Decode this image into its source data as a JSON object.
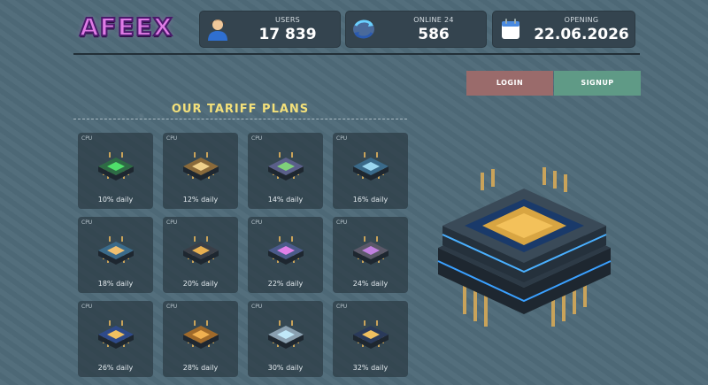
{
  "brand": {
    "logo_text": "AFEEX"
  },
  "stats": [
    {
      "label": "USERS",
      "value": "17 839",
      "icon": "user-icon"
    },
    {
      "label": "ONLINE 24",
      "value": "586",
      "icon": "sync-arrows-icon"
    },
    {
      "label": "OPENING",
      "value": "22.06.2026",
      "icon": "calendar-icon"
    }
  ],
  "auth": {
    "login_label": "LOGIN",
    "signup_label": "SIGNUP"
  },
  "plans": {
    "title": "OUR TARIFF PLANS",
    "items": [
      {
        "tag": "CPU",
        "rate": "10% daily",
        "core": "#4fe06a",
        "body": "#2e6b45"
      },
      {
        "tag": "CPU",
        "rate": "12% daily",
        "core": "#f0d08a",
        "body": "#8a6a3a"
      },
      {
        "tag": "CPU",
        "rate": "14% daily",
        "core": "#7fd07a",
        "body": "#5a5f8a"
      },
      {
        "tag": "CPU",
        "rate": "16% daily",
        "core": "#9ad6f0",
        "body": "#3a6a8a"
      },
      {
        "tag": "CPU",
        "rate": "18% daily",
        "core": "#f0c070",
        "body": "#3a6a8a"
      },
      {
        "tag": "CPU",
        "rate": "20% daily",
        "core": "#e8b050",
        "body": "#3a3f48"
      },
      {
        "tag": "CPU",
        "rate": "22% daily",
        "core": "#e080e8",
        "body": "#4a5a8a"
      },
      {
        "tag": "CPU",
        "rate": "24% daily",
        "core": "#c080e0",
        "body": "#5a5868"
      },
      {
        "tag": "CPU",
        "rate": "26% daily",
        "core": "#f0c060",
        "body": "#2e4a8a"
      },
      {
        "tag": "CPU",
        "rate": "28% daily",
        "core": "#f0b050",
        "body": "#a06a2a"
      },
      {
        "tag": "CPU",
        "rate": "30% daily",
        "core": "#c0e8f8",
        "body": "#8aa0b0"
      },
      {
        "tag": "CPU",
        "rate": "32% daily",
        "core": "#f0c060",
        "body": "#2a3a5a"
      }
    ]
  },
  "colors": {
    "accent_title": "#f3e07a",
    "login_bg": "#9a6b6b",
    "signup_bg": "#5f9a86",
    "panel_bg": "#34444f"
  }
}
